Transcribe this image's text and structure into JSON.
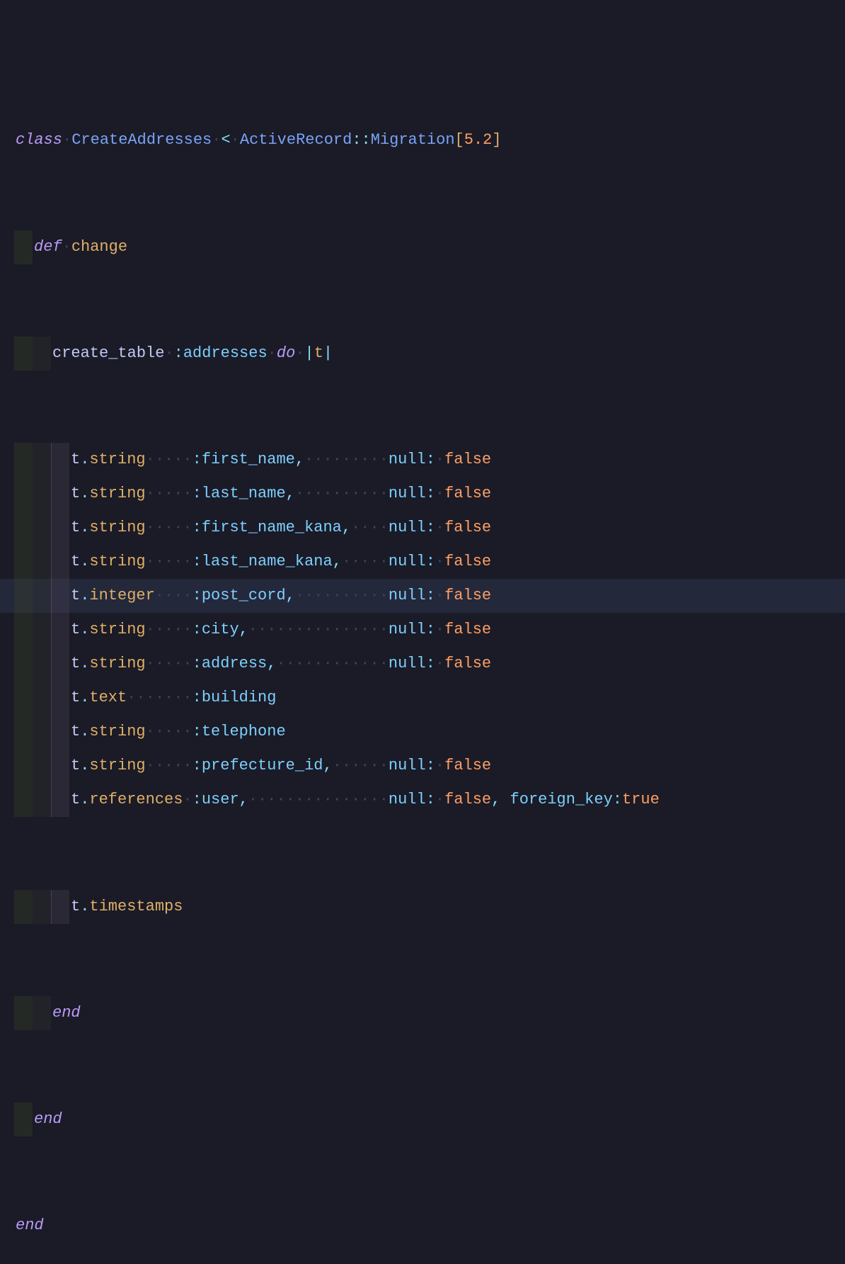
{
  "lines": {
    "l1": {
      "kw_class": "class",
      "dot1": "·",
      "cls_name": "CreateAddresses",
      "dot2": "·",
      "lt": "<",
      "dot3": "·",
      "mod1": "ActiveRecord",
      "dbl": "::",
      "mod2": "Migration",
      "lb": "[",
      "ver": "5.2",
      "rb": "]"
    },
    "l2": {
      "pad": "··",
      "kw_def": "def",
      "dot": "·",
      "fn_name": "change"
    },
    "l3": {
      "pad": "····",
      "fn": "create_table",
      "dot1": "·",
      "sym": ":addresses",
      "dot2": "·",
      "kw_do": "do",
      "dot3": "·",
      "pipe1": "|",
      "param": "t",
      "pipe2": "|"
    },
    "cols": [
      {
        "type": "string",
        "pad": "·····",
        "sym": ":first_name",
        "comma": ",",
        "pad2": "·········",
        "null": "null:",
        "dot": "·",
        "val": "false",
        "extra": ""
      },
      {
        "type": "string",
        "pad": "·····",
        "sym": ":last_name",
        "comma": ",",
        "pad2": "··········",
        "null": "null:",
        "dot": "·",
        "val": "false",
        "extra": ""
      },
      {
        "type": "string",
        "pad": "·····",
        "sym": ":first_name_kana",
        "comma": ",",
        "pad2": "····",
        "null": "null:",
        "dot": "·",
        "val": "false",
        "extra": ""
      },
      {
        "type": "string",
        "pad": "·····",
        "sym": ":last_name_kana",
        "comma": ",",
        "pad2": "·····",
        "null": "null:",
        "dot": "·",
        "val": "false",
        "extra": ""
      },
      {
        "type": "integer",
        "pad": "····",
        "sym": ":post_cord",
        "comma": ",",
        "pad2": "··········",
        "null": "null:",
        "dot": "·",
        "val": "false",
        "extra": "",
        "highlight": true
      },
      {
        "type": "string",
        "pad": "·····",
        "sym": ":city",
        "comma": ",",
        "pad2": "···············",
        "null": "null:",
        "dot": "·",
        "val": "false",
        "extra": ""
      },
      {
        "type": "string",
        "pad": "·····",
        "sym": ":address",
        "comma": ",",
        "pad2": "············",
        "null": "null:",
        "dot": "·",
        "val": "false",
        "extra": ""
      },
      {
        "type": "text",
        "pad": "·······",
        "sym": ":building",
        "comma": "",
        "pad2": "",
        "null": "",
        "dot": "",
        "val": "",
        "extra": ""
      },
      {
        "type": "string",
        "pad": "·····",
        "sym": ":telephone",
        "comma": "",
        "pad2": "",
        "null": "",
        "dot": "",
        "val": "",
        "extra": ""
      },
      {
        "type": "string",
        "pad": "·····",
        "sym": ":prefecture_id",
        "comma": ",",
        "pad2": "······",
        "null": "null:",
        "dot": "·",
        "val": "false",
        "extra": ""
      },
      {
        "type": "references",
        "pad": "·",
        "sym": ":user",
        "comma": ",",
        "pad2": "···············",
        "null": "null:",
        "dot": "·",
        "val": "false",
        "extra": ", ",
        "extra_key": "foreign_key:",
        "extra_val": "true"
      }
    ],
    "l_ts": {
      "pad": "······",
      "t": "t",
      "dot": ".",
      "ts": "timestamps"
    },
    "l_end1": {
      "pad": "····",
      "end": "end"
    },
    "l_end2": {
      "pad": "··",
      "end": "end"
    },
    "l_end3": {
      "end": "end"
    }
  }
}
